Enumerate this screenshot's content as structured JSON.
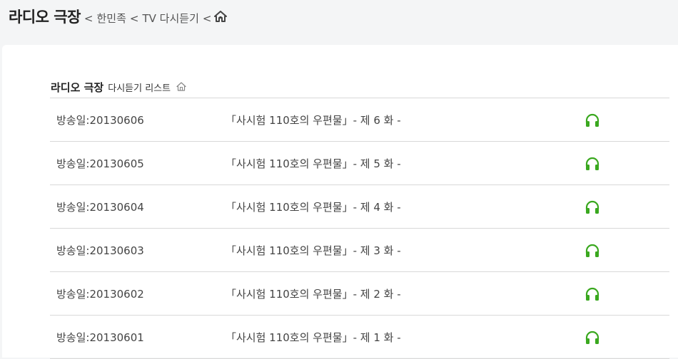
{
  "breadcrumb": {
    "title": "라디오 극장",
    "sep": "<",
    "items": [
      "한민족",
      "TV 다시듣기"
    ],
    "home_icon": "home-icon"
  },
  "list": {
    "title": "라디오 극장",
    "subtitle": "다시듣기 리스트",
    "home_icon": "home-icon",
    "accent": "#3aa81f",
    "rows": [
      {
        "date": "방송일:20130606",
        "episode": "「사시험 110호의 우편물」- 제 6 화 -"
      },
      {
        "date": "방송일:20130605",
        "episode": "「사시험 110호의 우편물」- 제 5 화 -"
      },
      {
        "date": "방송일:20130604",
        "episode": "「사시험 110호의 우편물」- 제 4 화 -"
      },
      {
        "date": "방송일:20130603",
        "episode": "「사시험 110호의 우편물」- 제 3 화 -"
      },
      {
        "date": "방송일:20130602",
        "episode": "「사시험 110호의 우편물」- 제 2 화 -"
      },
      {
        "date": "방송일:20130601",
        "episode": "「사시험 110호의 우편물」- 제 1 화 -"
      }
    ],
    "row_icon": "headphones-icon"
  }
}
